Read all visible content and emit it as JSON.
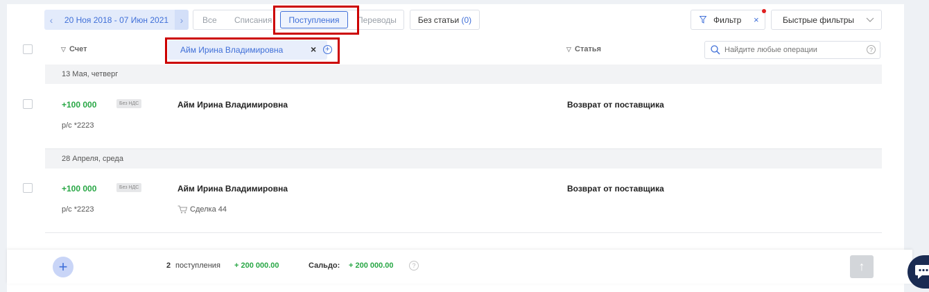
{
  "toolbar": {
    "date_range": "20 Ноя 2018 - 07 Июн 2021",
    "prev_arrow": "‹",
    "next_arrow": "›",
    "tabs": [
      "Все",
      "Списания",
      "Поступления",
      "Переводы"
    ],
    "active_tab": "Поступления",
    "no_article_label": "Без статьи",
    "no_article_count": "(0)",
    "filter_label": "Фильтр",
    "filter_clear": "×",
    "quick_filters_label": "Быстрые фильтры"
  },
  "columns": {
    "account": "Счет",
    "article": "Статья"
  },
  "chip": {
    "label": "Айм Ирина Владимировна",
    "remove": "×",
    "add": "+"
  },
  "search": {
    "placeholder": "Найдите любые операции",
    "help": "?"
  },
  "groups": [
    {
      "date": "13 Мая, четверг",
      "amount": "+100 000",
      "vat": "Без НДС",
      "counterparty": "Айм Ирина Владимировна",
      "account": "р/с *2223",
      "article": "Возврат от поставщика",
      "deal": ""
    },
    {
      "date": "28 Апреля, среда",
      "amount": "+100 000",
      "vat": "Без НДС",
      "counterparty": "Айм Ирина Владимировна",
      "account": "р/с *2223",
      "article": "Возврат от поставщика",
      "deal": "Сделка 44"
    }
  ],
  "footer": {
    "count": "2",
    "count_label": "поступления",
    "total": "+ 200 000.00",
    "balance_label": "Сальдо:",
    "balance": "+ 200 000.00",
    "help": "?",
    "add": "+",
    "up": "↑"
  },
  "colors": {
    "accent": "#3f6fd8",
    "positive": "#28a745",
    "highlight": "#cc0000"
  }
}
